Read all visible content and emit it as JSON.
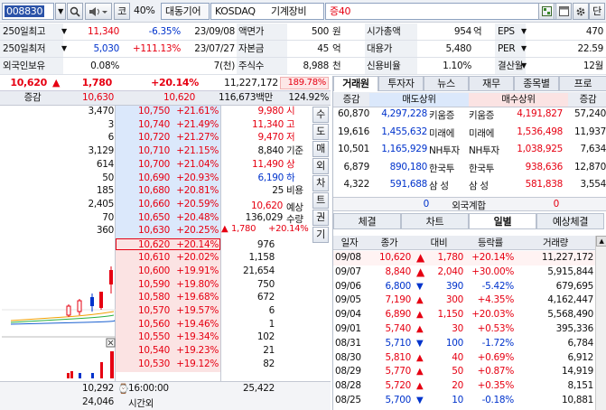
{
  "toolbar": {
    "code": "008830",
    "kor_btn": "코",
    "ratio": "40%",
    "category": "대동기어",
    "market": "KOSDAQ",
    "sector": "기계장비",
    "margin": "증40",
    "dan_btn": "단"
  },
  "info": {
    "rows": [
      [
        {
          "label": "250일최고",
          "value": "11,340",
          "change": "-6.35%",
          "date": "23/09/08"
        },
        {
          "label": "액면가",
          "value": "500",
          "unit": "원"
        },
        {
          "label": "시가총액",
          "value": "954",
          "unit": "억"
        },
        {
          "label": "EPS",
          "value": "470"
        }
      ],
      [
        {
          "label": "250일최저",
          "value": "5,030",
          "change": "+111.13%",
          "date": "23/07/27"
        },
        {
          "label": "자본금",
          "value": "45",
          "unit": "억"
        },
        {
          "label": "대용가",
          "value": "5,480"
        },
        {
          "label": "PER",
          "value": "22.59"
        }
      ],
      [
        {
          "label": "외국인보유",
          "value": "0.08%",
          "change": "",
          "date": "7(천)"
        },
        {
          "label": "주식수",
          "value": "8,988",
          "unit": "천"
        },
        {
          "label": "신용비율",
          "value": "1.10%"
        },
        {
          "label": "결산월",
          "value": "12월"
        }
      ]
    ]
  },
  "price": {
    "current": "10,620",
    "diff": "1,780",
    "rate": "+20.14%",
    "volume": "11,227,172",
    "vol_ratio": "189.78%"
  },
  "ob_header": {
    "label": "증감",
    "price1": "10,630",
    "price2": "10,620",
    "amount": "116,673백만",
    "strength": "124.92%"
  },
  "asks": [
    {
      "qty": "3,470",
      "price": "10,750",
      "rate": "+21.61%"
    },
    {
      "qty": "3",
      "price": "10,740",
      "rate": "+21.49%"
    },
    {
      "qty": "6",
      "price": "10,720",
      "rate": "+21.27%"
    },
    {
      "qty": "3,129",
      "price": "10,710",
      "rate": "+21.15%"
    },
    {
      "qty": "614",
      "price": "10,700",
      "rate": "+21.04%"
    },
    {
      "qty": "50",
      "price": "10,690",
      "rate": "+20.93%"
    },
    {
      "qty": "185",
      "price": "10,680",
      "rate": "+20.81%"
    },
    {
      "qty": "2,405",
      "price": "10,660",
      "rate": "+20.59%"
    },
    {
      "qty": "70",
      "price": "10,650",
      "rate": "+20.48%"
    },
    {
      "qty": "360",
      "price": "10,630",
      "rate": "+20.25%"
    }
  ],
  "bids": [
    {
      "price": "10,620",
      "rate": "+20.14%",
      "qty": "976"
    },
    {
      "price": "10,610",
      "rate": "+20.02%",
      "qty": "1,158"
    },
    {
      "price": "10,600",
      "rate": "+19.91%",
      "qty": "21,654"
    },
    {
      "price": "10,590",
      "rate": "+19.80%",
      "qty": "750"
    },
    {
      "price": "10,580",
      "rate": "+19.68%",
      "qty": "672"
    },
    {
      "price": "10,570",
      "rate": "+19.57%",
      "qty": "6"
    },
    {
      "price": "10,560",
      "rate": "+19.46%",
      "qty": "1"
    },
    {
      "price": "10,550",
      "rate": "+19.34%",
      "qty": "102"
    },
    {
      "price": "10,540",
      "rate": "+19.23%",
      "qty": "21"
    },
    {
      "price": "10,530",
      "rate": "+19.12%",
      "qty": "82"
    }
  ],
  "stats": [
    {
      "value": "9,980",
      "label": "시"
    },
    {
      "value": "11,340",
      "label": "고"
    },
    {
      "value": "9,470",
      "label": "저"
    },
    {
      "value": "8,840",
      "label": "기준"
    },
    {
      "value": "11,490",
      "label": "상"
    },
    {
      "value": "6,190",
      "label": "하"
    },
    {
      "value": "25",
      "label": "비용"
    }
  ],
  "expected": {
    "price": "10,620",
    "price_label": "예상",
    "qty": "136,029",
    "qty_label": "수량",
    "diff": "1,780",
    "rate": "+20.14%"
  },
  "side_buttons": [
    "수",
    "도",
    "매",
    "외",
    "차",
    "트",
    "권",
    "기"
  ],
  "ob_footer": {
    "ask_total": "10,292",
    "time": "16:00:00",
    "bid_total": "25,422",
    "net": "24,046",
    "after_label": "시간외"
  },
  "right_tabs": [
    "거래원",
    "투자자",
    "뉴스",
    "재무",
    "종목별",
    "프로"
  ],
  "broker": {
    "headers": [
      "증감",
      "매도상위",
      "매수상위",
      "증감"
    ],
    "rows": [
      {
        "chg1": "60,870",
        "sell_qty": "4,297,228",
        "sell_name": "키움증",
        "buy_name": "키움증",
        "buy_qty": "4,191,827",
        "chg2": "57,240"
      },
      {
        "chg1": "19,616",
        "sell_qty": "1,455,632",
        "sell_name": "미래에",
        "buy_name": "미래에",
        "buy_qty": "1,536,498",
        "chg2": "11,937"
      },
      {
        "chg1": "10,501",
        "sell_qty": "1,165,929",
        "sell_name": "NH투자",
        "buy_name": "NH투자",
        "buy_qty": "1,038,925",
        "chg2": "7,634"
      },
      {
        "chg1": "6,879",
        "sell_qty": "890,180",
        "sell_name": "한국투",
        "buy_name": "한국투",
        "buy_qty": "938,636",
        "chg2": "12,870"
      },
      {
        "chg1": "4,322",
        "sell_qty": "591,688",
        "sell_name": "삼 성",
        "buy_name": "삼 성",
        "buy_qty": "581,838",
        "chg2": "3,554"
      }
    ],
    "foreign": {
      "sell": "0",
      "label": "외국계합",
      "buy": "0"
    }
  },
  "sub_tabs": [
    "체결",
    "차트",
    "일별",
    "예상체결"
  ],
  "daily": {
    "headers": [
      "일자",
      "종가",
      "대비",
      "등락률",
      "거래량"
    ],
    "rows": [
      {
        "date": "09/08",
        "close": "10,620",
        "dir": "upper",
        "diff": "1,780",
        "rate": "+20.14%",
        "vol": "11,227,172"
      },
      {
        "date": "09/07",
        "close": "8,840",
        "dir": "upper",
        "diff": "2,040",
        "rate": "+30.00%",
        "vol": "5,915,844"
      },
      {
        "date": "09/06",
        "close": "6,800",
        "dir": "down",
        "diff": "390",
        "rate": "-5.42%",
        "vol": "679,695"
      },
      {
        "date": "09/05",
        "close": "7,190",
        "dir": "up",
        "diff": "300",
        "rate": "+4.35%",
        "vol": "4,162,447"
      },
      {
        "date": "09/04",
        "close": "6,890",
        "dir": "up",
        "diff": "1,150",
        "rate": "+20.03%",
        "vol": "5,568,490"
      },
      {
        "date": "09/01",
        "close": "5,740",
        "dir": "up",
        "diff": "30",
        "rate": "+0.53%",
        "vol": "395,336"
      },
      {
        "date": "08/31",
        "close": "5,710",
        "dir": "down",
        "diff": "100",
        "rate": "-1.72%",
        "vol": "6,784"
      },
      {
        "date": "08/30",
        "close": "5,810",
        "dir": "up",
        "diff": "40",
        "rate": "+0.69%",
        "vol": "6,912"
      },
      {
        "date": "08/29",
        "close": "5,770",
        "dir": "up",
        "diff": "50",
        "rate": "+0.87%",
        "vol": "14,919"
      },
      {
        "date": "08/28",
        "close": "5,720",
        "dir": "up",
        "diff": "20",
        "rate": "+0.35%",
        "vol": "8,151"
      },
      {
        "date": "08/25",
        "close": "5,700",
        "dir": "down",
        "diff": "10",
        "rate": "-0.18%",
        "vol": "10,881"
      }
    ]
  },
  "colors": {
    "up": "#e60012",
    "down": "#0033cc",
    "ask_bg": "#dbe8fb",
    "bid_bg": "#fbe3e3"
  },
  "icons": [
    "search-icon",
    "dropdown-icon",
    "speaker-icon",
    "grid-icon",
    "window-icon",
    "settings-icon"
  ]
}
